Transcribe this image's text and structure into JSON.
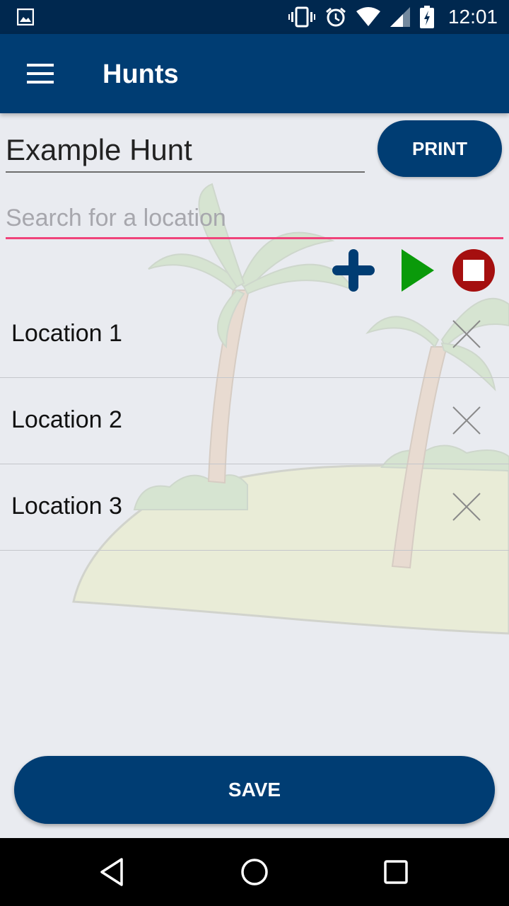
{
  "status_bar": {
    "time": "12:01",
    "icons": [
      "image-icon",
      "vibrate-icon",
      "alarm-icon",
      "wifi-icon",
      "signal-icon",
      "battery-icon"
    ]
  },
  "app_bar": {
    "title": "Hunts",
    "menu_icon": "hamburger-menu-icon"
  },
  "hunt": {
    "name": "Example Hunt",
    "print_label": "PRINT"
  },
  "search": {
    "placeholder": "Search for a location",
    "value": ""
  },
  "actions": {
    "add_icon": "plus-icon",
    "play_icon": "play-icon",
    "stop_icon": "stop-icon"
  },
  "locations": [
    {
      "label": "Location 1"
    },
    {
      "label": "Location 2"
    },
    {
      "label": "Location 3"
    }
  ],
  "save_label": "SAVE",
  "colors": {
    "primary": "#003d73",
    "status_bar": "#00284f",
    "accent_underline": "#f0437a",
    "play_green": "#0a9a0a",
    "stop_red": "#a50f0f",
    "background": "#e9ebf0"
  }
}
